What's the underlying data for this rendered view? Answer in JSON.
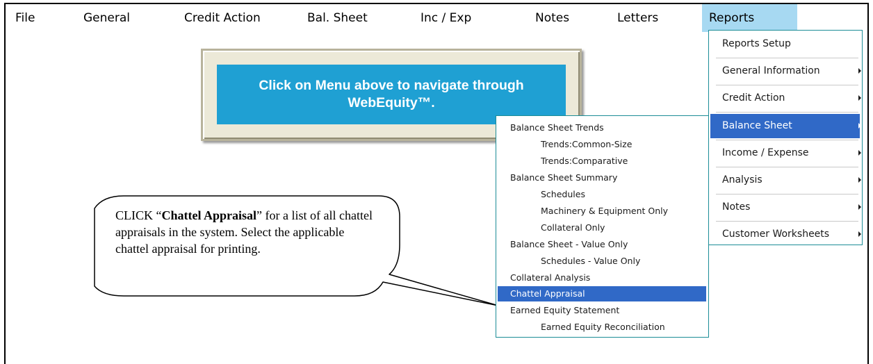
{
  "menubar": {
    "items": [
      {
        "label": "File"
      },
      {
        "label": "General"
      },
      {
        "label": "Credit Action"
      },
      {
        "label": "Bal. Sheet"
      },
      {
        "label": "Inc / Exp"
      },
      {
        "label": "Notes"
      },
      {
        "label": "Letters"
      },
      {
        "label": "Reports"
      }
    ]
  },
  "banner": {
    "text": "Click on Menu above to navigate through WebEquity™."
  },
  "reports_menu": {
    "items": [
      {
        "label": "Reports Setup",
        "has_submenu": false
      },
      {
        "label": "General Information",
        "has_submenu": true
      },
      {
        "label": "Credit Action",
        "has_submenu": true
      },
      {
        "label": "Balance Sheet",
        "has_submenu": true
      },
      {
        "label": "Income / Expense",
        "has_submenu": true
      },
      {
        "label": "Analysis",
        "has_submenu": true
      },
      {
        "label": "Notes",
        "has_submenu": true
      },
      {
        "label": "Customer Worksheets",
        "has_submenu": true
      }
    ]
  },
  "balance_sheet_submenu": {
    "items": [
      {
        "label": "Balance Sheet Trends"
      },
      {
        "label": "Trends:Common-Size"
      },
      {
        "label": "Trends:Comparative"
      },
      {
        "label": "Balance Sheet Summary"
      },
      {
        "label": "Schedules"
      },
      {
        "label": "Machinery & Equipment Only"
      },
      {
        "label": "Collateral Only"
      },
      {
        "label": "Balance Sheet - Value Only"
      },
      {
        "label": "Schedules - Value Only"
      },
      {
        "label": "Collateral Analysis"
      },
      {
        "label": "Chattel Appraisal"
      },
      {
        "label": "Earned Equity Statement"
      },
      {
        "label": "Earned Equity Reconciliation"
      }
    ]
  },
  "callout": {
    "prefix": "CLICK “",
    "bold": "Chattel Appraisal",
    "suffix": "” for a list of all chattel appraisals in the system.  Select the applicable chattel appraisal for printing."
  },
  "colors": {
    "menu_active": "#a7d9f2",
    "banner_bg": "#1fa0d3",
    "selection": "#3069c7",
    "menu_border": "#1b8c96"
  }
}
